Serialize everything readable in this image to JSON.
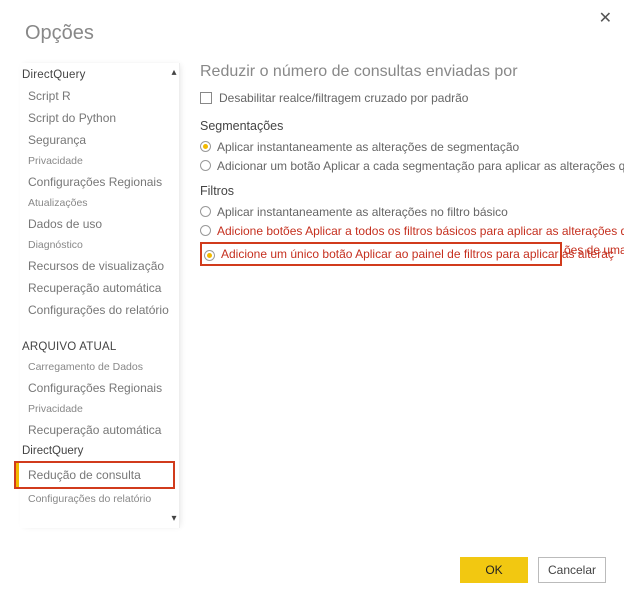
{
  "dialog": {
    "title": "Opções"
  },
  "sidebar": {
    "sec1": "DirectQuery",
    "items1": [
      "Script R",
      "Script do Python",
      "Segurança",
      "Privacidade",
      "Configurações Regionais",
      "Atualizações",
      "Dados de uso",
      "Diagnóstico",
      "Recursos de visualização",
      "Recuperação automática",
      "Configurações do relatório"
    ],
    "sec2": "ARQUIVO ATUAL",
    "items2": [
      "Carregamento de Dados",
      "Configurações Regionais",
      "Privacidade",
      "Recuperação automática",
      "DirectQuery",
      "Redução de consulta",
      "Configurações do relatório"
    ]
  },
  "main": {
    "title": "Reduzir o número de consultas enviadas por",
    "disable_highlight": "Desabilitar realce/filtragem cruzado por padrão",
    "seg_head": "Segmentações",
    "seg_opt1": "Aplicar instantaneamente as alterações de segmentação",
    "seg_opt2": "Adicionar um botão Aplicar a cada segmentação para aplicar as alterações qu",
    "fil_head": "Filtros",
    "fil_opt1": "Aplicar instantaneamente as alterações no filtro básico",
    "fil_opt2": "Adicione botões Aplicar a todos os filtros básicos para aplicar as alterações qu",
    "fil_opt3_a": "Adicione um único botão Aplicar ao painel de filtros para aplicar as alteraç",
    "fil_opt3_b": "ões de uma vez"
  },
  "footer": {
    "ok": "OK",
    "cancel": "Cancelar"
  }
}
